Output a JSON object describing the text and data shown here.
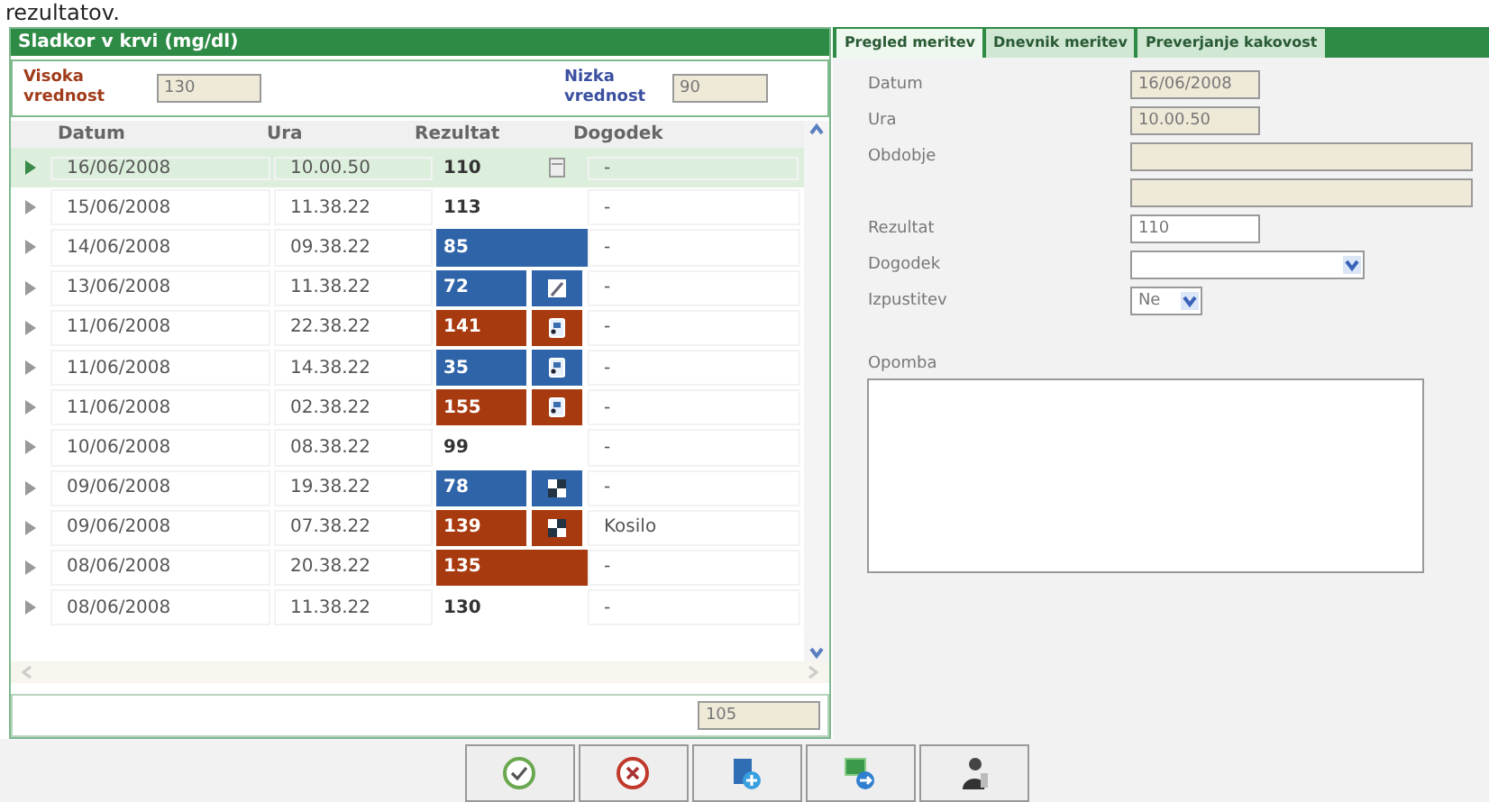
{
  "caption": "rezultatov.",
  "panel": {
    "title": "Sladkor v krvi (mg/dl)",
    "thresholds": [
      {
        "kind": "high",
        "label": "Visoka vrednost",
        "value": "130"
      },
      {
        "kind": "low",
        "label": "Nizka vrednost",
        "value": "90"
      }
    ],
    "columns": [
      "Datum",
      "Ura",
      "Rezultat",
      "Dogodek"
    ],
    "rows": [
      {
        "date": "16/06/2008",
        "time": "10.00.50",
        "result": {
          "text": "110"
        },
        "marker": {
          "kind": "note"
        },
        "event": "-",
        "selected": true
      },
      {
        "date": "15/06/2008",
        "time": "11.38.22",
        "result": {
          "text": "113"
        },
        "event": "-",
        "selected": false
      },
      {
        "date": "14/06/2008",
        "time": "09.38.22",
        "result": {
          "text": "85",
          "color": "#2f64a8"
        },
        "event": "-",
        "selected": false
      },
      {
        "date": "13/06/2008",
        "time": "11.38.22",
        "result": {
          "text": "72",
          "color": "#2f64a8"
        },
        "marker": {
          "kind": "pencil"
        },
        "event": "-",
        "selected": false
      },
      {
        "date": "11/06/2008",
        "time": "22.38.22",
        "result": {
          "text": "141",
          "color": "#a83a10"
        },
        "marker": {
          "kind": "device"
        },
        "event": "-",
        "selected": false
      },
      {
        "date": "11/06/2008",
        "time": "14.38.22",
        "result": {
          "text": "35",
          "color": "#2f64a8"
        },
        "marker": {
          "kind": "device"
        },
        "event": "-",
        "selected": false
      },
      {
        "date": "11/06/2008",
        "time": "02.38.22",
        "result": {
          "text": "155",
          "color": "#a83a10"
        },
        "marker": {
          "kind": "device"
        },
        "event": "-",
        "selected": false
      },
      {
        "date": "10/06/2008",
        "time": "08.38.22",
        "result": {
          "text": "99"
        },
        "event": "-",
        "selected": false
      },
      {
        "date": "09/06/2008",
        "time": "19.38.22",
        "result": {
          "text": "78",
          "color": "#2f64a8"
        },
        "marker": {
          "kind": "grid"
        },
        "event": "-",
        "selected": false
      },
      {
        "date": "09/06/2008",
        "time": "07.38.22",
        "result": {
          "text": "139",
          "color": "#a83a10"
        },
        "marker": {
          "kind": "grid"
        },
        "event": "Kosilo",
        "selected": false
      },
      {
        "date": "08/06/2008",
        "time": "20.38.22",
        "result": {
          "text": "135",
          "color": "#a83a10"
        },
        "event": "-",
        "selected": false
      },
      {
        "date": "08/06/2008",
        "time": "11.38.22",
        "result": {
          "text": "130"
        },
        "event": "-",
        "selected": false
      }
    ],
    "average": "105"
  },
  "tabs": [
    {
      "label": "Pregled meritev",
      "selected": true
    },
    {
      "label": "Dnevnik meritev",
      "selected": false
    },
    {
      "label": "Preverjanje kakovost",
      "selected": false
    }
  ],
  "form": [
    {
      "kind": "stamp",
      "label": "Datum",
      "value": "16/06/2008"
    },
    {
      "kind": "stamp",
      "label": "Ura",
      "value": "10.00.50"
    },
    {
      "kind": "period",
      "label": "Obdobje"
    },
    {
      "kind": "period"
    },
    {
      "kind": "text",
      "label": "Rezultat",
      "value": "110"
    },
    {
      "kind": "select",
      "label": "Dogodek"
    },
    {
      "kind": "toggle",
      "label": "Izpustitev",
      "value": "Ne"
    },
    {
      "kind": "textarea",
      "label": "Opomba"
    }
  ],
  "buttons": [
    {
      "kind": "confirm"
    },
    {
      "kind": "cancel"
    },
    {
      "kind": "add"
    },
    {
      "kind": "export"
    },
    {
      "kind": "person"
    }
  ]
}
